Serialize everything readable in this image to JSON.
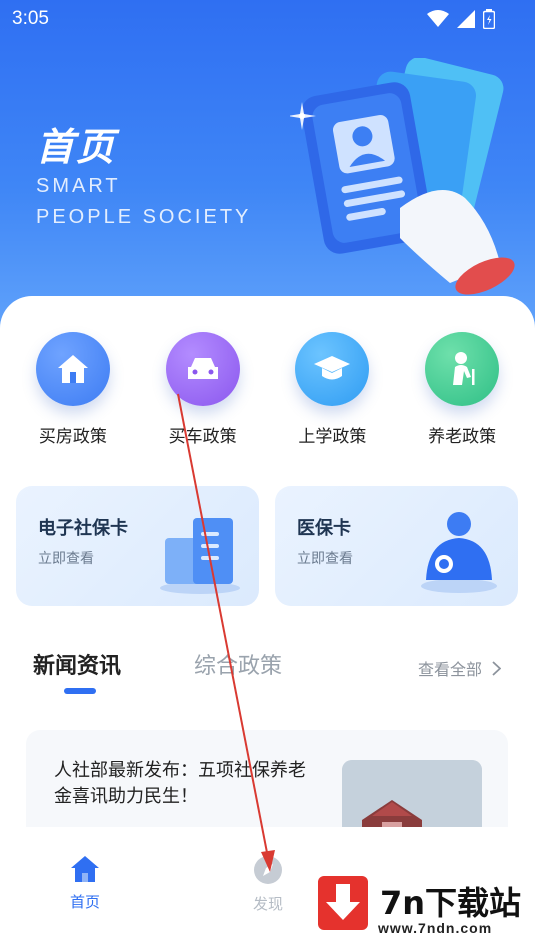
{
  "status_bar": {
    "time": "3:05"
  },
  "hero": {
    "title": "首页",
    "subtitle_line1": "SMART",
    "subtitle_line2": "PEOPLE SOCIETY"
  },
  "quick_actions": [
    {
      "label": "买房政策",
      "icon": "house-icon",
      "color": "#3d7cf3"
    },
    {
      "label": "买车政策",
      "icon": "car-icon",
      "color": "#8b57ee"
    },
    {
      "label": "上学政策",
      "icon": "graduation-cap-icon",
      "color": "#2f9cf3"
    },
    {
      "label": "养老政策",
      "icon": "elderly-person-icon",
      "color": "#2fbf86"
    }
  ],
  "cards": [
    {
      "title": "电子社保卡",
      "subtitle": "立即查看"
    },
    {
      "title": "医保卡",
      "subtitle": "立即查看"
    }
  ],
  "news": {
    "tabs": [
      "新闻资讯",
      "综合政策"
    ],
    "view_all": "查看全部",
    "items": [
      {
        "title": "人社部最新发布：五项社保养老金喜讯助力民生！"
      }
    ]
  },
  "bottom_nav": [
    {
      "label": "首页",
      "icon": "home-icon"
    },
    {
      "label": "发现",
      "icon": "compass-icon"
    }
  ],
  "watermark": {
    "brand": "7n下载站",
    "url": "www.7ndn.com"
  },
  "colors": {
    "primary": "#2f6ff2",
    "annotation_arrow": "#d93a32"
  }
}
